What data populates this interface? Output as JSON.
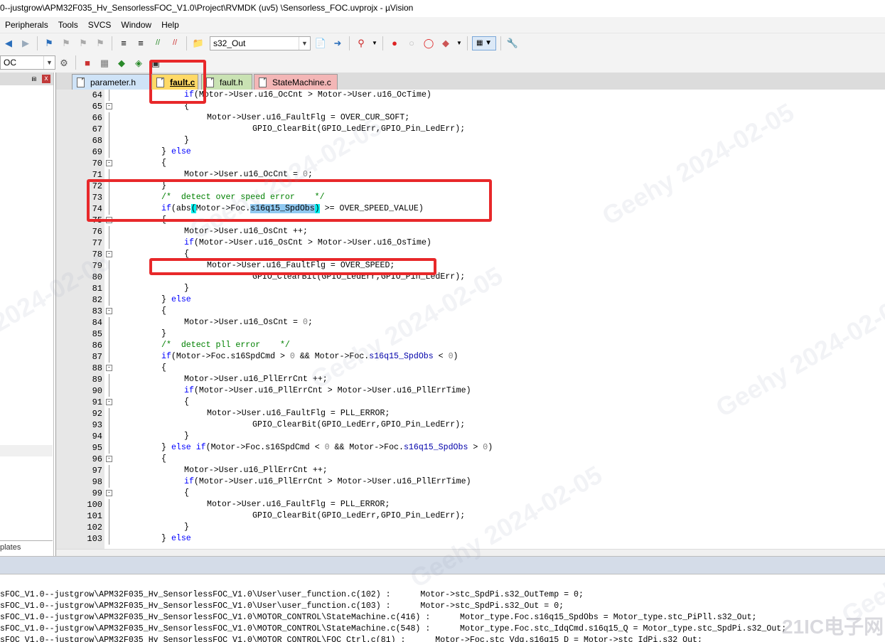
{
  "window": {
    "title": "0--justgrow\\APM32F035_Hv_SensorlessFOC_V1.0\\Project\\RVMDK  (uv5)  \\Sensorless_FOC.uvprojx - µVision"
  },
  "menu": [
    "Peripherals",
    "Tools",
    "SVCS",
    "Window",
    "Help"
  ],
  "toolbar": {
    "target_combo": "s32_Out",
    "project_combo": "OC"
  },
  "left_pane": {
    "bottom_tab": "plates",
    "pin": "⩎",
    "close": "x"
  },
  "tabs": [
    {
      "label": "parameter.h"
    },
    {
      "label": "fault.c"
    },
    {
      "label": "fault.h"
    },
    {
      "label": "StateMachine.c"
    }
  ],
  "code_lines": [
    {
      "n": "64",
      "fold": ""
    },
    {
      "n": "65",
      "fold": "-"
    },
    {
      "n": "66",
      "fold": ""
    },
    {
      "n": "67",
      "fold": ""
    },
    {
      "n": "68",
      "fold": ""
    },
    {
      "n": "69",
      "fold": ""
    },
    {
      "n": "70",
      "fold": "-"
    },
    {
      "n": "71",
      "fold": ""
    },
    {
      "n": "72",
      "fold": ""
    },
    {
      "n": "73",
      "fold": ""
    },
    {
      "n": "74",
      "fold": ""
    },
    {
      "n": "75",
      "fold": "-"
    },
    {
      "n": "76",
      "fold": ""
    },
    {
      "n": "77",
      "fold": ""
    },
    {
      "n": "78",
      "fold": "-"
    },
    {
      "n": "79",
      "fold": ""
    },
    {
      "n": "80",
      "fold": ""
    },
    {
      "n": "81",
      "fold": ""
    },
    {
      "n": "82",
      "fold": ""
    },
    {
      "n": "83",
      "fold": "-"
    },
    {
      "n": "84",
      "fold": ""
    },
    {
      "n": "85",
      "fold": ""
    },
    {
      "n": "86",
      "fold": ""
    },
    {
      "n": "87",
      "fold": ""
    },
    {
      "n": "88",
      "fold": "-"
    },
    {
      "n": "89",
      "fold": ""
    },
    {
      "n": "90",
      "fold": ""
    },
    {
      "n": "91",
      "fold": "-"
    },
    {
      "n": "92",
      "fold": ""
    },
    {
      "n": "93",
      "fold": ""
    },
    {
      "n": "94",
      "fold": ""
    },
    {
      "n": "95",
      "fold": ""
    },
    {
      "n": "96",
      "fold": "-"
    },
    {
      "n": "97",
      "fold": ""
    },
    {
      "n": "98",
      "fold": ""
    },
    {
      "n": "99",
      "fold": "-"
    },
    {
      "n": "100",
      "fold": ""
    },
    {
      "n": "101",
      "fold": ""
    },
    {
      "n": "102",
      "fold": ""
    },
    {
      "n": "103",
      "fold": ""
    }
  ],
  "code_text": {
    "l64_a": "if",
    "l64_b": "(Motor->User.u16_OcCnt > Motor->User.u16_OcTime)",
    "l65": "{",
    "l66": "Motor->User.u16_FaultFlg = OVER_CUR_SOFT;",
    "l67": "GPIO_ClearBit(GPIO_LedErr,GPIO_Pin_LedErr);",
    "l68": "}",
    "l69_a": "}",
    "l69_b": "else",
    "l70": "{",
    "l71_a": "Motor->User.u16_OcCnt = ",
    "l71_b": "0",
    "l71_c": ";",
    "l72": "}",
    "l73": "/*  detect over speed error    */",
    "l74_a": "if",
    "l74_b": "(abs",
    "l74_c": "(",
    "l74_d": "Motor->Foc.",
    "l74_e": "s16q15_SpdObs",
    "l74_f": ")",
    "l74_g": " >= OVER_SPEED_VALUE)",
    "l75": "{",
    "l76": "Motor->User.u16_OsCnt ++;",
    "l77_a": "if",
    "l77_b": "(Motor->User.u16_OsCnt > Motor->User.u16_OsTime)",
    "l78": "{",
    "l79": "Motor->User.u16_FaultFlg = OVER_SPEED;",
    "l80": "GPIO_ClearBit(GPIO_LedErr,GPIO_Pin_LedErr);",
    "l81": "}",
    "l82_a": "}",
    "l82_b": "else",
    "l83": "{",
    "l84_a": "Motor->User.u16_OsCnt = ",
    "l84_b": "0",
    "l84_c": ";",
    "l85": "}",
    "l86": "/*  detect pll error    */",
    "l87_a": "if",
    "l87_b": "(Motor->Foc.s16SpdCmd > ",
    "l87_c": "0",
    "l87_d": " && Motor->Foc.",
    "l87_e": "s16q15_SpdObs",
    "l87_f": " < ",
    "l87_g": "0",
    "l87_h": ")",
    "l88": "{",
    "l89": "Motor->User.u16_PllErrCnt ++;",
    "l90_a": "if",
    "l90_b": "(Motor->User.u16_PllErrCnt > Motor->User.u16_PllErrTime)",
    "l91": "{",
    "l92": "Motor->User.u16_FaultFlg = PLL_ERROR;",
    "l93": "GPIO_ClearBit(GPIO_LedErr,GPIO_Pin_LedErr);",
    "l94": "}",
    "l95_a": "}",
    "l95_b": "else if",
    "l95_c": "(Motor->Foc.s16SpdCmd < ",
    "l95_d": "0",
    "l95_e": " && Motor->Foc.",
    "l95_f": "s16q15_SpdObs",
    "l95_g": " > ",
    "l95_h": "0",
    "l95_i": ")",
    "l96": "{",
    "l97": "Motor->User.u16_PllErrCnt ++;",
    "l98_a": "if",
    "l98_b": "(Motor->User.u16_PllErrCnt > Motor->User.u16_PllErrTime)",
    "l99": "{",
    "l100": "Motor->User.u16_FaultFlg = PLL_ERROR;",
    "l101": "GPIO_ClearBit(GPIO_LedErr,GPIO_Pin_LedErr);",
    "l102": "}",
    "l103_a": "}",
    "l103_b": "else"
  },
  "output_lines": [
    "sFOC_V1.0--justgrow\\APM32F035_Hv_SensorlessFOC_V1.0\\User\\user_function.c(102) :      Motor->stc_SpdPi.s32_OutTemp = 0;",
    "sFOC_V1.0--justgrow\\APM32F035_Hv_SensorlessFOC_V1.0\\User\\user_function.c(103) :      Motor->stc_SpdPi.s32_Out = 0;",
    "sFOC_V1.0--justgrow\\APM32F035_Hv_SensorlessFOC_V1.0\\MOTOR_CONTROL\\StateMachine.c(416) :      Motor_type.Foc.s16q15_SpdObs = Motor_type.stc_PiPll.s32_Out;",
    "sFOC_V1.0--justgrow\\APM32F035_Hv_SensorlessFOC_V1.0\\MOTOR_CONTROL\\StateMachine.c(548) :      Motor_type.Foc.stc_IdqCmd.s16q15_Q = Motor_type.stc_SpdPi.s32_Out;",
    "sFOC_V1.0--justgrow\\APM32F035_Hv_SensorlessFOC_V1.0\\MOTOR_CONTROL\\FOC_Ctrl.c(81) :      Motor->Foc.stc_Vdq.s16q15_D = Motor->stc_IdPi.s32_Out;"
  ],
  "watermarks": [
    "Geehy  2024-02-05",
    "Geehy  2024-02-05",
    "Geehy  2024-02-05",
    "Geehy  2024-02-05",
    "Geehy  2024-02-05",
    "2024-02-05",
    "Geehy",
    "21IC电子网"
  ],
  "colors": {
    "keyword": "#0000ff",
    "comment": "#008000",
    "number": "#808080",
    "highlight": "#8fc8f0",
    "bracket_match": "#00f0f0",
    "annotation": "#e8282a"
  }
}
